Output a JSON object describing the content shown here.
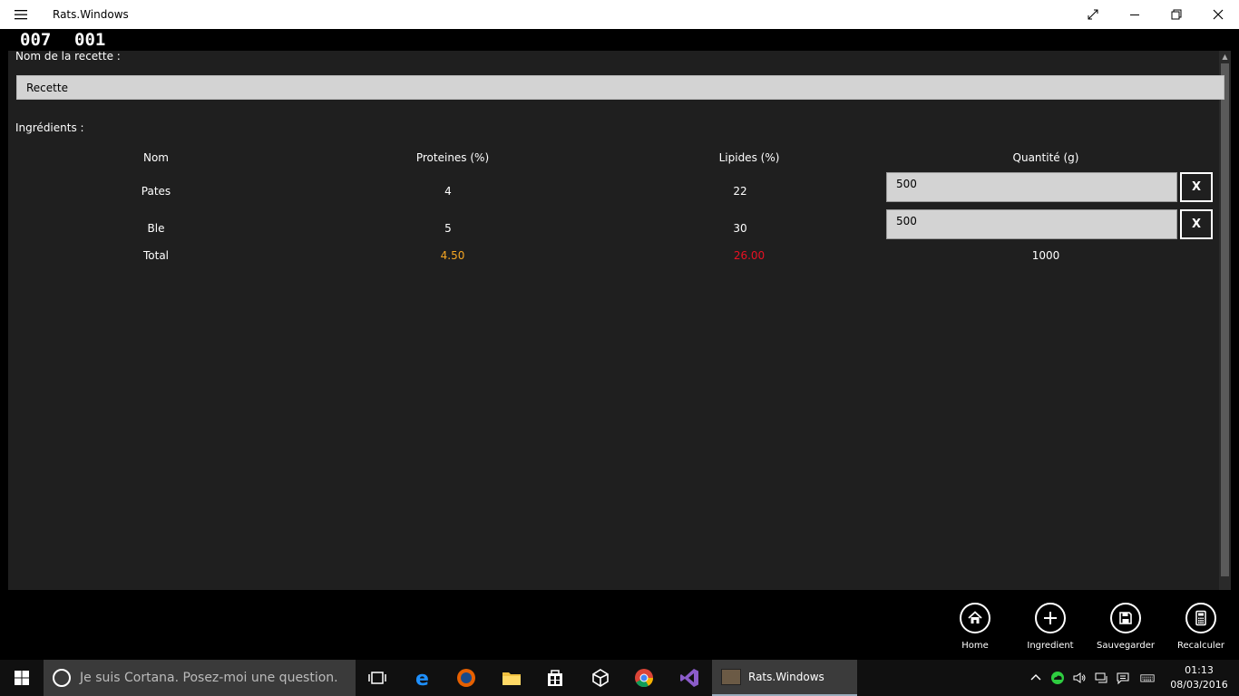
{
  "window": {
    "title": "Rats.Windows"
  },
  "frame_counters": [
    "007",
    "001"
  ],
  "recipe": {
    "name_label": "Nom de la recette :",
    "name_value": "Recette",
    "ingredients_label": "Ingrédients :"
  },
  "table": {
    "headers": {
      "name": "Nom",
      "proteins": "Proteines (%)",
      "lipids": "Lipides (%)",
      "quantity": "Quantité (g)"
    },
    "rows": [
      {
        "name": "Pates",
        "proteins": "4",
        "lipids": "22",
        "quantity": "500",
        "remove": "X"
      },
      {
        "name": "Ble",
        "proteins": "5",
        "lipids": "30",
        "quantity": "500",
        "remove": "X"
      }
    ],
    "total": {
      "label": "Total",
      "proteins": "4.50",
      "lipids": "26.00",
      "quantity": "1000"
    },
    "colors": {
      "proteins_total": "#f5a623",
      "lipids_total": "#e81123"
    }
  },
  "commands": [
    {
      "label": "Home",
      "icon": "home-icon"
    },
    {
      "label": "Ingredient",
      "icon": "plus-icon"
    },
    {
      "label": "Sauvegarder",
      "icon": "save-icon"
    },
    {
      "label": "Recalculer",
      "icon": "calculator-icon"
    }
  ],
  "taskbar": {
    "search_placeholder": "Je suis Cortana. Posez-moi une question.",
    "active_app": "Rats.Windows",
    "time": "01:13",
    "date": "08/03/2016"
  }
}
